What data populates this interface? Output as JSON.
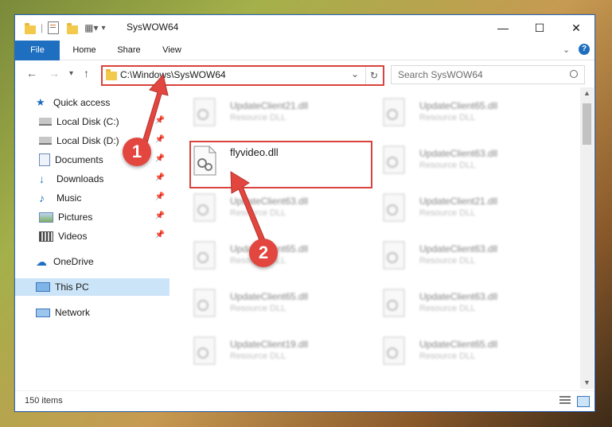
{
  "window": {
    "title": "SysWOW64",
    "minimize_glyph": "—",
    "maximize_glyph": "☐",
    "close_glyph": "✕"
  },
  "ribbon": {
    "tabs": [
      "File",
      "Home",
      "Share",
      "View"
    ]
  },
  "address": {
    "path": "C:\\Windows\\SysWOW64",
    "search_placeholder": "Search SysWOW64"
  },
  "nav": {
    "items": [
      {
        "label": "Quick access",
        "icon": "star-icon"
      },
      {
        "label": "Local Disk (C:)",
        "icon": "drive-icon"
      },
      {
        "label": "Local Disk (D:)",
        "icon": "drive-icon"
      },
      {
        "label": "Documents",
        "icon": "documents-icon"
      },
      {
        "label": "Downloads",
        "icon": "download-icon"
      },
      {
        "label": "Music",
        "icon": "music-icon"
      },
      {
        "label": "Pictures",
        "icon": "pictures-icon"
      },
      {
        "label": "Videos",
        "icon": "videos-icon"
      },
      {
        "label": "OneDrive",
        "icon": "cloud-icon"
      },
      {
        "label": "This PC",
        "icon": "computer-icon"
      },
      {
        "label": "Network",
        "icon": "network-icon"
      }
    ]
  },
  "files": {
    "highlighted": {
      "name": "flyvideo.dll"
    },
    "left": [
      {
        "name": "UpdateClient21.dll",
        "type": "Resource DLL"
      },
      {
        "name": "UpdateClient63.dll",
        "type": "Resource DLL"
      },
      {
        "name": "UpdateClient65.dll",
        "type": "Resource DLL"
      },
      {
        "name": "UpdateClient65.dll",
        "type": "Resource DLL"
      },
      {
        "name": "UpdateClient19.dll",
        "type": "Resource DLL"
      }
    ],
    "right": [
      {
        "name": "UpdateClient65.dll",
        "type": "Resource DLL"
      },
      {
        "name": "UpdateClient63.dll",
        "type": "Resource DLL"
      },
      {
        "name": "UpdateClient21.dll",
        "type": "Resource DLL"
      },
      {
        "name": "UpdateClient63.dll",
        "type": "Resource DLL"
      },
      {
        "name": "UpdateClient63.dll",
        "type": "Resource DLL"
      },
      {
        "name": "UpdateClient65.dll",
        "type": "Resource DLL"
      }
    ]
  },
  "status": {
    "item_count": "150 items"
  },
  "annotations": {
    "step1": "1",
    "step2": "2",
    "color": "#e2463f"
  }
}
